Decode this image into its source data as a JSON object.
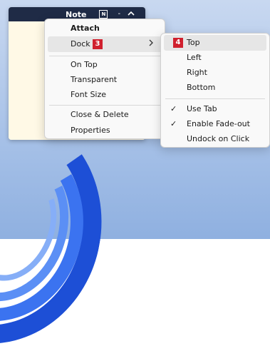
{
  "note": {
    "title": "Note",
    "n_button": "N",
    "minimize_glyph": "-",
    "collapse_glyph": "^"
  },
  "context_menu": {
    "attach": "Attach",
    "dock": "Dock",
    "dock_arrow": ">",
    "on_top": "On Top",
    "transparent": "Transparent",
    "font_size": "Font Size",
    "close_delete": "Close & Delete",
    "properties": "Properties"
  },
  "dock_submenu": {
    "top": "Top",
    "left": "Left",
    "right": "Right",
    "bottom": "Bottom",
    "use_tab": "Use Tab",
    "enable_fade_out": "Enable Fade-out",
    "undock_on_click": "Undock on Click",
    "check_glyph": "✓"
  },
  "callouts": {
    "dock_step": "3",
    "top_step": "4"
  },
  "colors": {
    "note_titlebar": "#1f2b46",
    "note_body": "#fff9e6",
    "badge": "#d0202e",
    "hover": "#e6e6e6"
  }
}
